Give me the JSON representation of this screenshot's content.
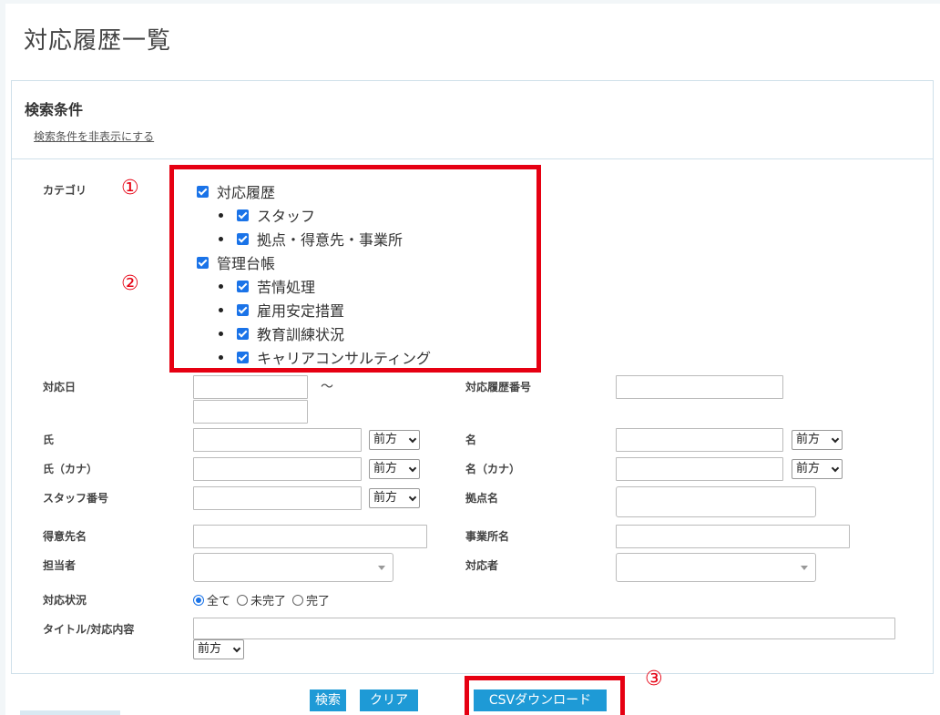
{
  "page": {
    "title": "対応履歴一覧"
  },
  "search_panel": {
    "title": "検索条件",
    "toggle_link": "検索条件を非表示にする"
  },
  "markers": {
    "m1": "①",
    "m2": "②",
    "m3": "③"
  },
  "category": {
    "label": "カテゴリ",
    "groups": [
      {
        "label": "対応履歴",
        "checked": true,
        "children": [
          {
            "label": "スタッフ",
            "checked": true
          },
          {
            "label": "拠点・得意先・事業所",
            "checked": true
          }
        ]
      },
      {
        "label": "管理台帳",
        "checked": true,
        "children": [
          {
            "label": "苦情処理",
            "checked": true
          },
          {
            "label": "雇用安定措置",
            "checked": true
          },
          {
            "label": "教育訓練状況",
            "checked": true
          },
          {
            "label": "キャリアコンサルティング",
            "checked": true
          }
        ]
      }
    ]
  },
  "fields": {
    "date_label": "対応日",
    "date_separator": "～",
    "history_no_label": "対応履歴番号",
    "last_name_label": "氏",
    "first_name_label": "名",
    "last_kana_label": "氏（カナ）",
    "first_kana_label": "名（カナ）",
    "staff_no_label": "スタッフ番号",
    "site_label": "拠点名",
    "client_label": "得意先名",
    "office_label": "事業所名",
    "assignee_label": "担当者",
    "handler_label": "対応者",
    "status_label": "対応状況",
    "title_label": "タイトル/対応内容",
    "match_mode": "前方"
  },
  "status_options": [
    {
      "label": "全て",
      "selected": true
    },
    {
      "label": "未完了",
      "selected": false
    },
    {
      "label": "完了",
      "selected": false
    }
  ],
  "buttons": {
    "search": "検索",
    "clear": "クリア",
    "csv": "CSVダウンロード"
  },
  "colors": {
    "accent": "#1e9ad6",
    "highlight": "#e60012",
    "checkbox": "#1a73e8"
  }
}
